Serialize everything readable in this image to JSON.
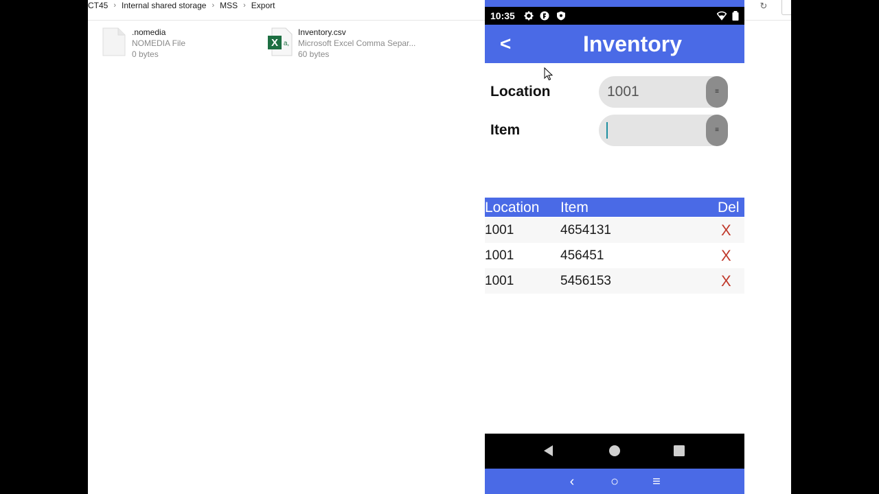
{
  "explorer": {
    "breadcrumbs": [
      "CT45",
      "Internal shared storage",
      "MSS",
      "Export"
    ],
    "breadcrumb_separator": "›",
    "files": [
      {
        "name": ".nomedia",
        "type": "NOMEDIA File",
        "size": "0 bytes",
        "icon": "blank-file-icon"
      },
      {
        "name": "Inventory.csv",
        "type": "Microsoft Excel Comma Separ...",
        "size": "60 bytes",
        "icon": "excel-csv-icon"
      }
    ],
    "excel_badge": "X",
    "excel_sub": "a,",
    "refresh_glyph": "↻"
  },
  "phone": {
    "status": {
      "time": "10:35",
      "icons": [
        "gear-icon",
        "app-badge-icon",
        "shield-icon",
        "wifi-icon",
        "battery-icon"
      ]
    },
    "appbar": {
      "back_label": "<",
      "title": "Inventory"
    },
    "form": {
      "location_label": "Location",
      "location_value": "1001",
      "item_label": "Item",
      "item_value": "",
      "dropdown_glyph": "≡"
    },
    "table": {
      "headers": {
        "location": "Location",
        "item": "Item",
        "del": "Del"
      },
      "rows": [
        {
          "location": "1001",
          "item": "4654131",
          "del": "X"
        },
        {
          "location": "1001",
          "item": "456451",
          "del": "X"
        },
        {
          "location": "1001",
          "item": "5456153",
          "del": "X"
        }
      ]
    },
    "host_nav": {
      "back": "‹",
      "home": "○",
      "menu": "≡"
    }
  },
  "colors": {
    "accent": "#4a6ae6",
    "delete": "#c0392b",
    "excel_green": "#1d6f42"
  }
}
